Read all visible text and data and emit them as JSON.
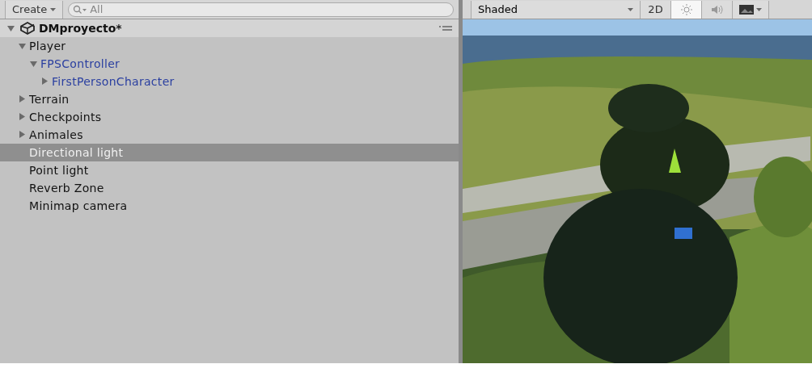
{
  "hierarchy": {
    "create_button": "Create",
    "search": {
      "placeholder": "All"
    },
    "scene": {
      "name": "DMproyecto*",
      "expanded": true
    },
    "items": [
      {
        "name": "Player",
        "foldable": true,
        "expanded": true,
        "prefab": false,
        "selected": false,
        "children": [
          {
            "name": "FPSController",
            "foldable": true,
            "expanded": true,
            "prefab": true,
            "selected": false,
            "children": [
              {
                "name": "FirstPersonCharacter",
                "foldable": true,
                "expanded": false,
                "prefab": true,
                "selected": false
              }
            ]
          }
        ]
      },
      {
        "name": "Terrain",
        "foldable": true,
        "expanded": false,
        "prefab": false,
        "selected": false
      },
      {
        "name": "Checkpoints",
        "foldable": true,
        "expanded": false,
        "prefab": false,
        "selected": false
      },
      {
        "name": "Animales",
        "foldable": true,
        "expanded": false,
        "prefab": false,
        "selected": false
      },
      {
        "name": "Directional light",
        "foldable": false,
        "prefab": false,
        "selected": true
      },
      {
        "name": "Point light",
        "foldable": false,
        "prefab": false,
        "selected": false
      },
      {
        "name": "Reverb Zone",
        "foldable": false,
        "prefab": false,
        "selected": false
      },
      {
        "name": "Minimap camera",
        "foldable": false,
        "prefab": false,
        "selected": false
      }
    ]
  },
  "scene_view": {
    "draw_mode": "Shaded",
    "toggles": [
      {
        "kind": "text",
        "label": "2D",
        "selected": false
      },
      {
        "kind": "light",
        "selected": true
      },
      {
        "kind": "audio",
        "selected": false
      },
      {
        "kind": "effects",
        "selected": false
      }
    ]
  }
}
